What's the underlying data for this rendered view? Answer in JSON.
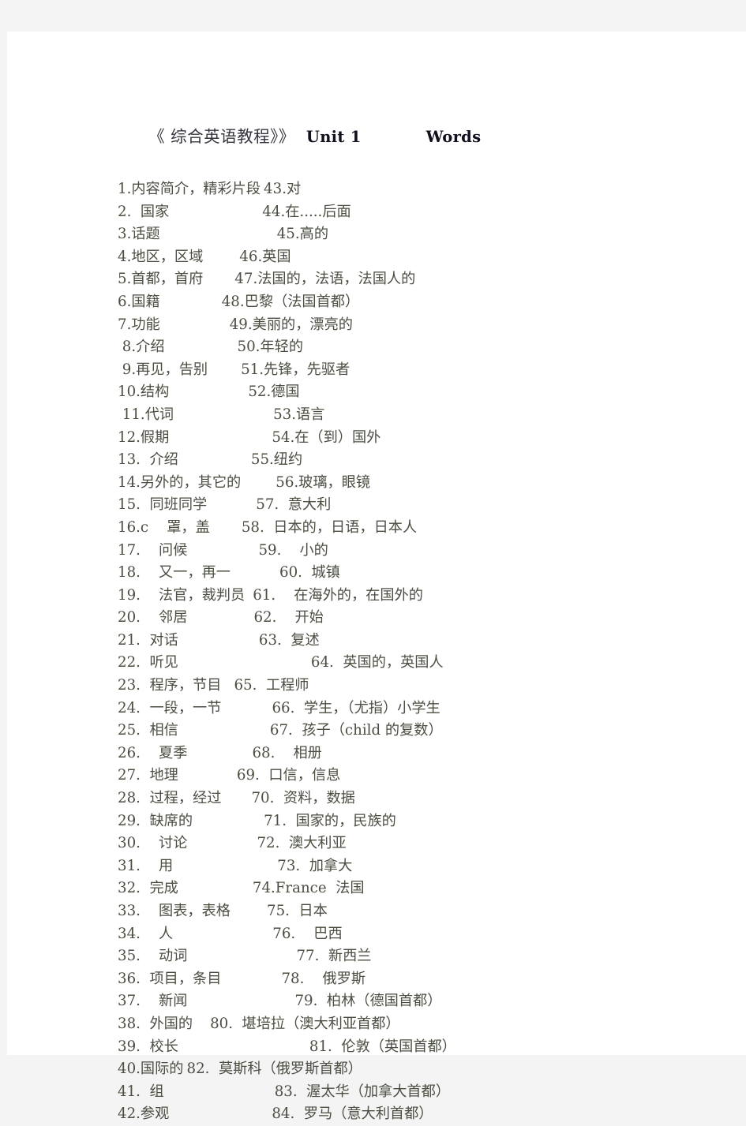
{
  "document": {
    "title": {
      "book": "《 综合英语教程》》",
      "unit": "Unit 1",
      "section": "Words"
    },
    "entries": [
      {
        "left": "1.内容简介，精彩片段",
        "gap": 4,
        "right": "43.对"
      },
      {
        "left": "2.  国家",
        "gap": 118,
        "right": "44.在.....后面"
      },
      {
        "left": "3.话题",
        "gap": 148,
        "right": "45.高的"
      },
      {
        "left": "4.地区，区域",
        "gap": 46,
        "right": "46.英国"
      },
      {
        "left": "5.首都，首府",
        "gap": 40,
        "right": "47.法国的，法语，法国人的"
      },
      {
        "left": "6.国籍",
        "gap": 78,
        "right": "48.巴黎（法国首都）"
      },
      {
        "left": "7.功能",
        "gap": 88,
        "right": "49.美丽的，漂亮的"
      },
      {
        "left": " 8.介绍",
        "gap": 92,
        "right": "50.年轻的"
      },
      {
        "left": " 9.再见，告别",
        "gap": 42,
        "right": "51.先锋，先驱者"
      },
      {
        "left": "10.结构",
        "gap": 100,
        "right": "52.德国"
      },
      {
        "left": " 11.代词",
        "gap": 126,
        "right": "53.语言"
      },
      {
        "left": "12.假期",
        "gap": 130,
        "right": "54.在（到）国外"
      },
      {
        "left": "13.  介绍",
        "gap": 92,
        "right": "55.纽约"
      },
      {
        "left": "14.另外的，其它的",
        "gap": 44,
        "right": "56.玻璃，眼镜"
      },
      {
        "left": "15.  同班同学",
        "gap": 62,
        "right": "57.  意大利"
      },
      {
        "left": "16.c    罩，盖",
        "gap": 40,
        "right": "58.  日本的，日语，日本人"
      },
      {
        "left": "17.    问候",
        "gap": 90,
        "right": "59.    小的"
      },
      {
        "left": "18.    又一，再一",
        "gap": 62,
        "right": "60.  城镇"
      },
      {
        "left": "19.    法官，裁判员",
        "gap": 10,
        "right": "61.    在海外的，在国外的"
      },
      {
        "left": "20.    邻居",
        "gap": 84,
        "right": "62.    开始"
      },
      {
        "left": "21.  对话",
        "gap": 102,
        "right": "63.  复述"
      },
      {
        "left": "22.  听见",
        "gap": 168,
        "right": "64.  英国的，英国人"
      },
      {
        "left": "23.  程序，节目",
        "gap": 16,
        "right": "65.  工程师"
      },
      {
        "left": "24.  一段，一节",
        "gap": 64,
        "right": "66.  学生，（尤指）小学生"
      },
      {
        "left": "25.  相信",
        "gap": 116,
        "right": "67.  孩子（child 的复数）"
      },
      {
        "left": "26.    夏季",
        "gap": 82,
        "right": "68.    相册"
      },
      {
        "left": "27.  地理",
        "gap": 74,
        "right": "69.  口信，信息"
      },
      {
        "left": "28.  过程，经过",
        "gap": 38,
        "right": "70.  资料，数据"
      },
      {
        "left": "29.  缺席的",
        "gap": 90,
        "right": "71.  国家的，民族的"
      },
      {
        "left": "30.    讨论",
        "gap": 88,
        "right": "72.  澳大利亚"
      },
      {
        "left": "31.    用",
        "gap": 132,
        "right": "73.  加拿大"
      },
      {
        "left": "32.  完成",
        "gap": 94,
        "right": "74.France  法国"
      },
      {
        "left": "33.    图表，表格",
        "gap": 46,
        "right": "75.  日本"
      },
      {
        "left": "34.    人",
        "gap": 126,
        "right": "76.    巴西"
      },
      {
        "left": "35.    动词",
        "gap": 138,
        "right": "77.  新西兰"
      },
      {
        "left": "36.  项目，条目",
        "gap": 76,
        "right": "78.    俄罗斯"
      },
      {
        "left": "37.    新闻",
        "gap": 136,
        "right": "79.  柏林（德国首都）"
      },
      {
        "left": "38.  外国的",
        "gap": 22,
        "right": "80.  堪培拉（澳大利亚首都）"
      },
      {
        "left": "39.  校长",
        "gap": 166,
        "right": "81.  伦敦（英国首都）"
      },
      {
        "left": "40.国际的",
        "gap": 4,
        "right": "82.  莫斯科（俄罗斯首都）"
      },
      {
        "left": "41.  组",
        "gap": 140,
        "right": "83.  渥太华（加拿大首都）"
      },
      {
        "left": "42.参观",
        "gap": 130,
        "right": "84.  罗马（意大利首都）"
      }
    ]
  }
}
